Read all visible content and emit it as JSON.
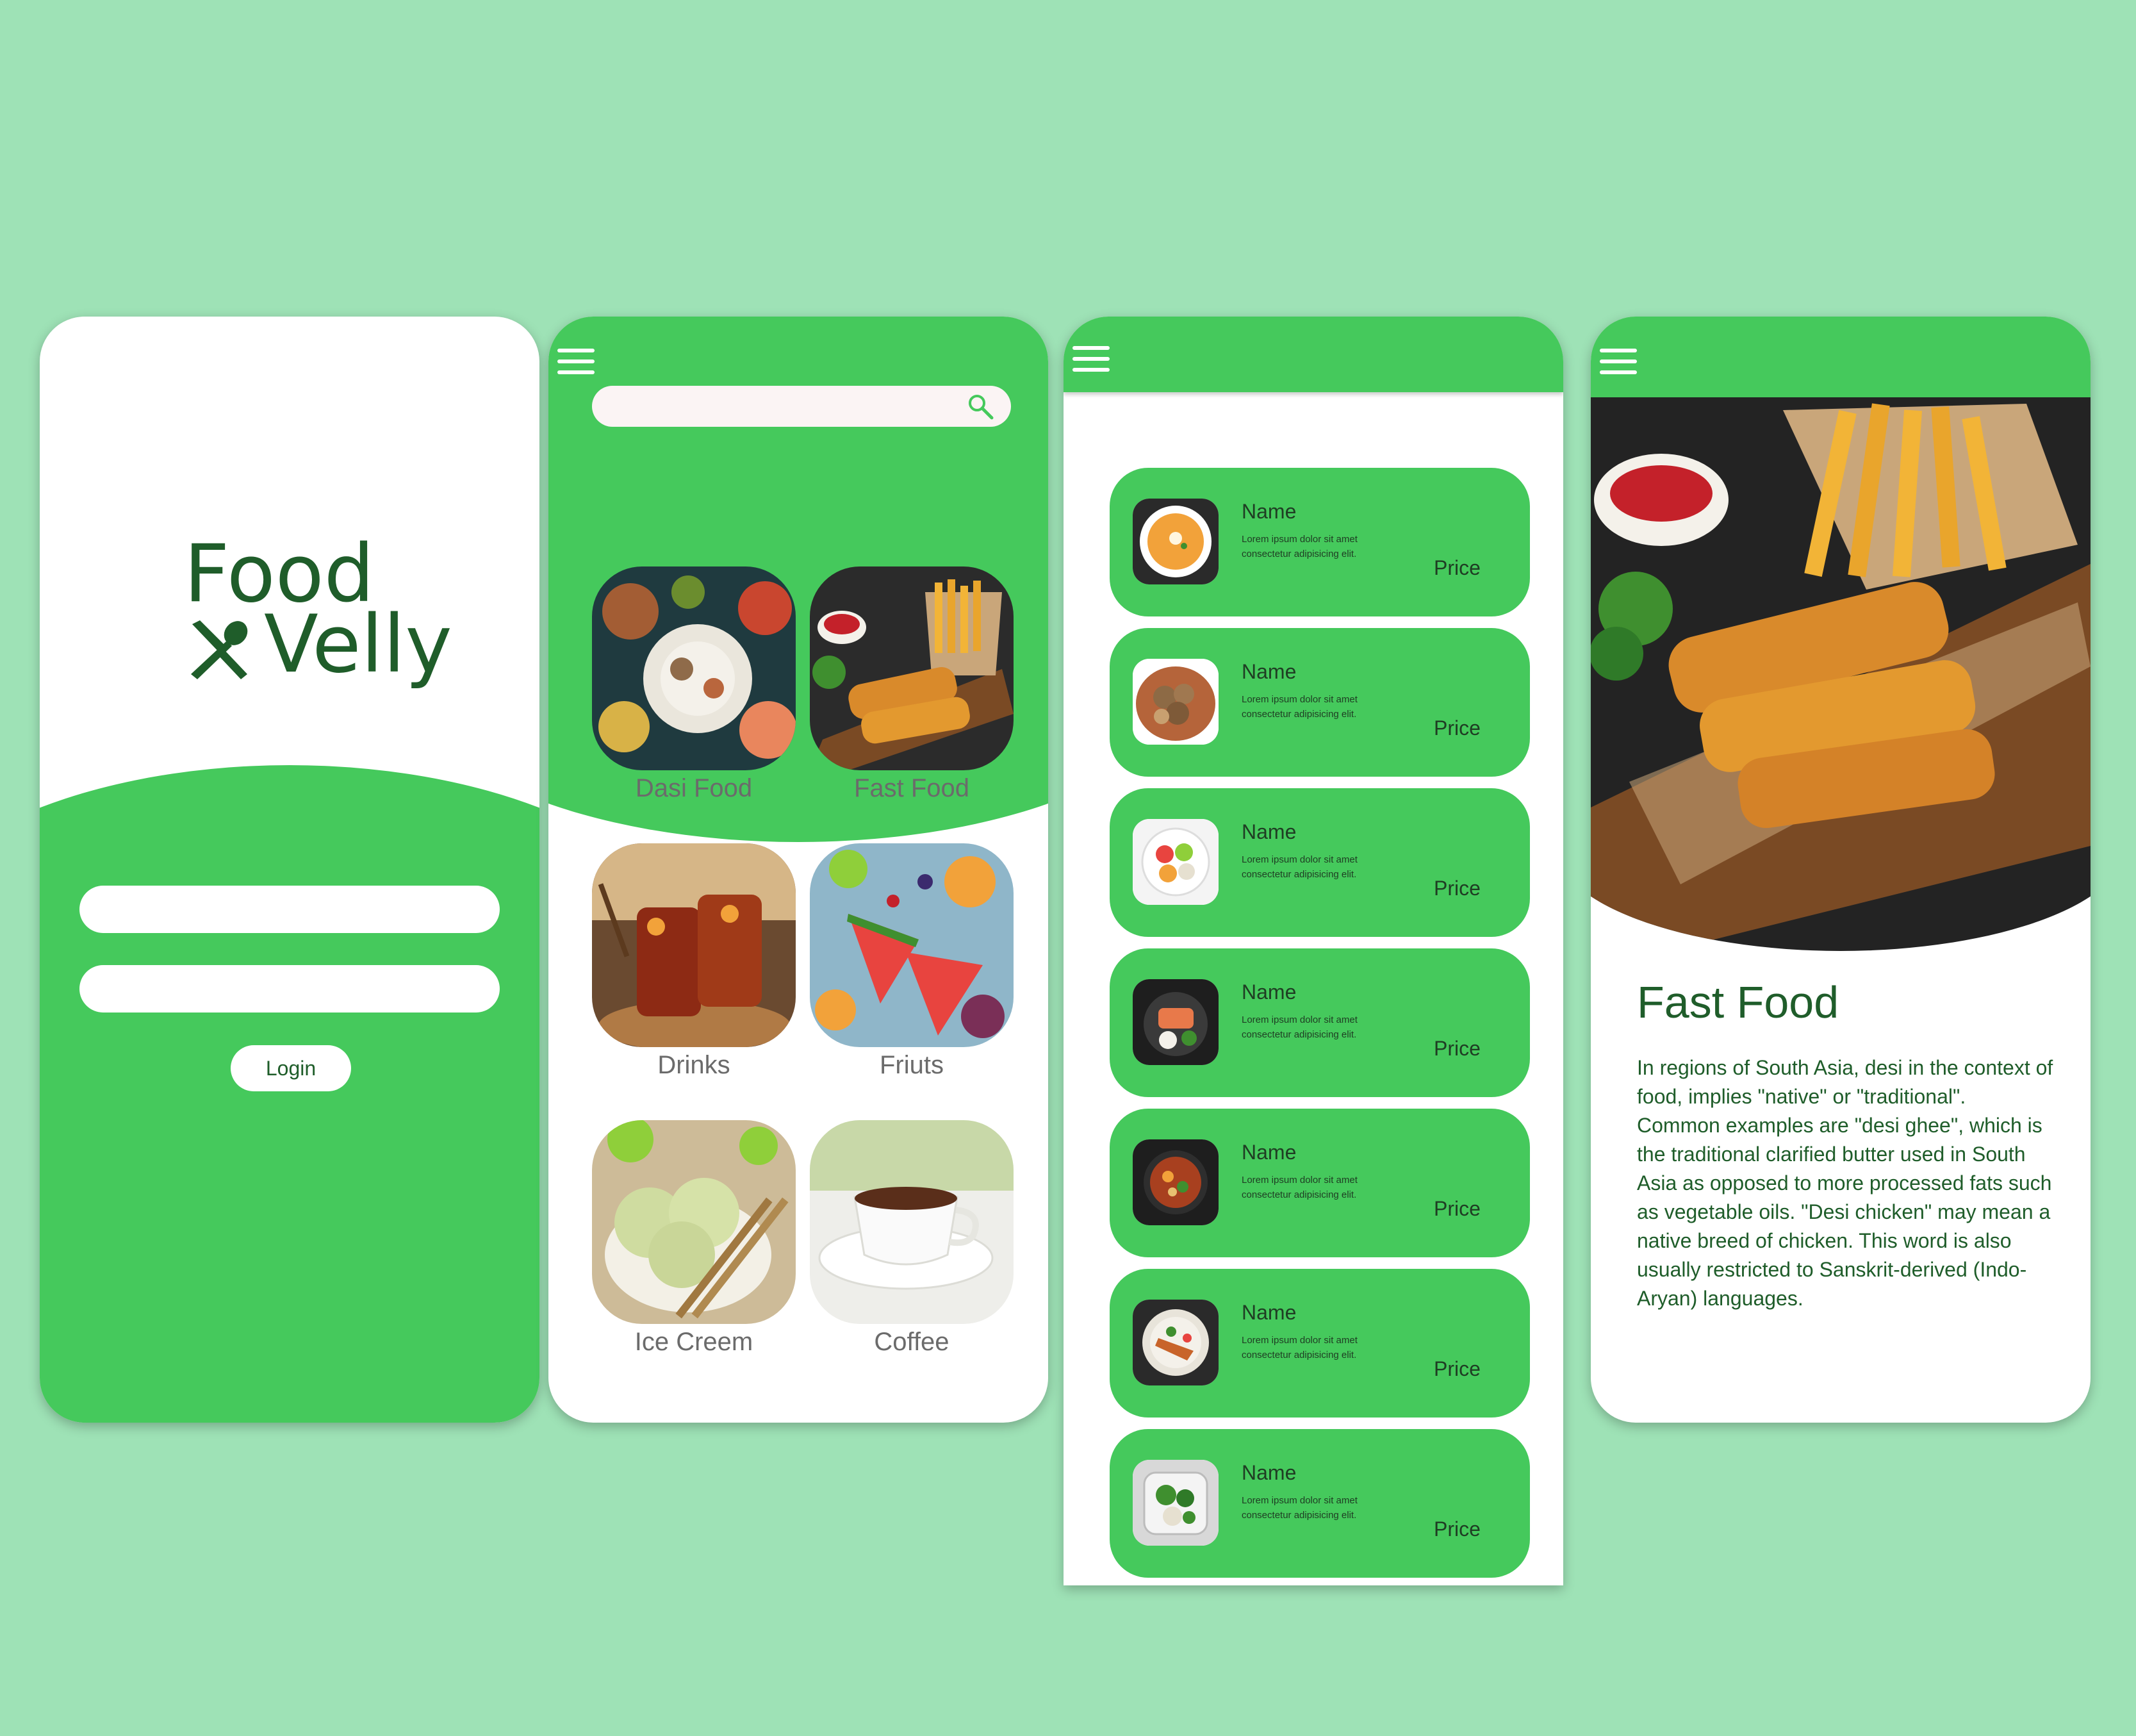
{
  "brand": {
    "line1": "Food",
    "line2": "Velly"
  },
  "login": {
    "username_placeholder": "",
    "password_placeholder": "",
    "button_label": "Login"
  },
  "search": {
    "placeholder": ""
  },
  "categories": [
    {
      "label": "Dasi Food"
    },
    {
      "label": "Fast Food"
    },
    {
      "label": "Drinks"
    },
    {
      "label": "Friuts"
    },
    {
      "label": "Ice Creem"
    },
    {
      "label": "Coffee"
    }
  ],
  "items": [
    {
      "name": "Name",
      "description": "Lorem ipsum dolor sit amet consectetur adipisicing elit.",
      "price": "Price"
    },
    {
      "name": "Name",
      "description": "Lorem ipsum dolor sit amet consectetur adipisicing elit.",
      "price": "Price"
    },
    {
      "name": "Name",
      "description": "Lorem ipsum dolor sit amet consectetur adipisicing elit.",
      "price": "Price"
    },
    {
      "name": "Name",
      "description": "Lorem ipsum dolor sit amet consectetur adipisicing elit.",
      "price": "Price"
    },
    {
      "name": "Name",
      "description": "Lorem ipsum dolor sit amet consectetur adipisicing elit.",
      "price": "Price"
    },
    {
      "name": "Name",
      "description": "Lorem ipsum dolor sit amet consectetur adipisicing elit.",
      "price": "Price"
    },
    {
      "name": "Name",
      "description": "Lorem ipsum dolor sit amet consectetur adipisicing elit.",
      "price": "Price"
    }
  ],
  "detail": {
    "title": "Fast Food",
    "body": "In regions of South Asia, desi in the context of food, implies \"native\" or \"traditional\".\nCommon examples are \"desi ghee\", which is the traditional clarified butter used in South Asia as opposed to more processed fats such as vegetable oils. \"Desi chicken\" may mean a native breed of chicken. This word is also usually restricted to Sanskrit-derived (Indo-Aryan) languages."
  },
  "colors": {
    "background": "#9ee2b6",
    "accent": "#45c95c",
    "brand_text": "#1f5d2a",
    "label_text": "#6b6b6b"
  },
  "icons": [
    "fork-spoon-icon",
    "menu-icon",
    "search-icon"
  ]
}
